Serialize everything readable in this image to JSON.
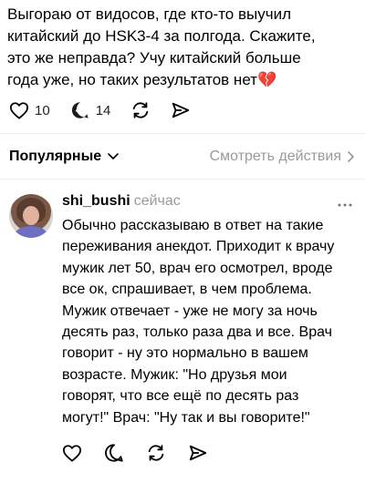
{
  "post": {
    "text": "Выгораю от видосов, где кто-то выучил\nкитайский до HSK3-4 за полгода. Скажите,\nэто же неправда? Учу китайский больше\nгода уже, но таких результатов нет",
    "emoji": "💔",
    "likes": "10",
    "comments": "14"
  },
  "sort": {
    "label": "Популярные",
    "view_actions_label": "Смотреть действия"
  },
  "comment": {
    "username": "shi_bushi",
    "time": "сейчас",
    "text": "Обычно рассказываю в ответ на такие\nпереживания анекдот. Приходит к врачу\nмужик лет 50, врач его осмотрел, вроде\nвсе ок, спрашивает, в чем проблема.\nМужик отвечает - уже не могу за ночь\nдесять раз, только раза два и все. Врач\nговорит - ну это нормально в вашем\nвозрасте. Мужик: \"Но друзья мои\nговорят, что все ещё по десять раз\nмогут!\" Врач: \"Ну так и вы говорите!\""
  },
  "icons": {
    "like": "heart-icon",
    "comment": "comment-bubble-icon",
    "repost": "repost-icon",
    "share": "send-icon",
    "more": "more-dots-icon"
  }
}
